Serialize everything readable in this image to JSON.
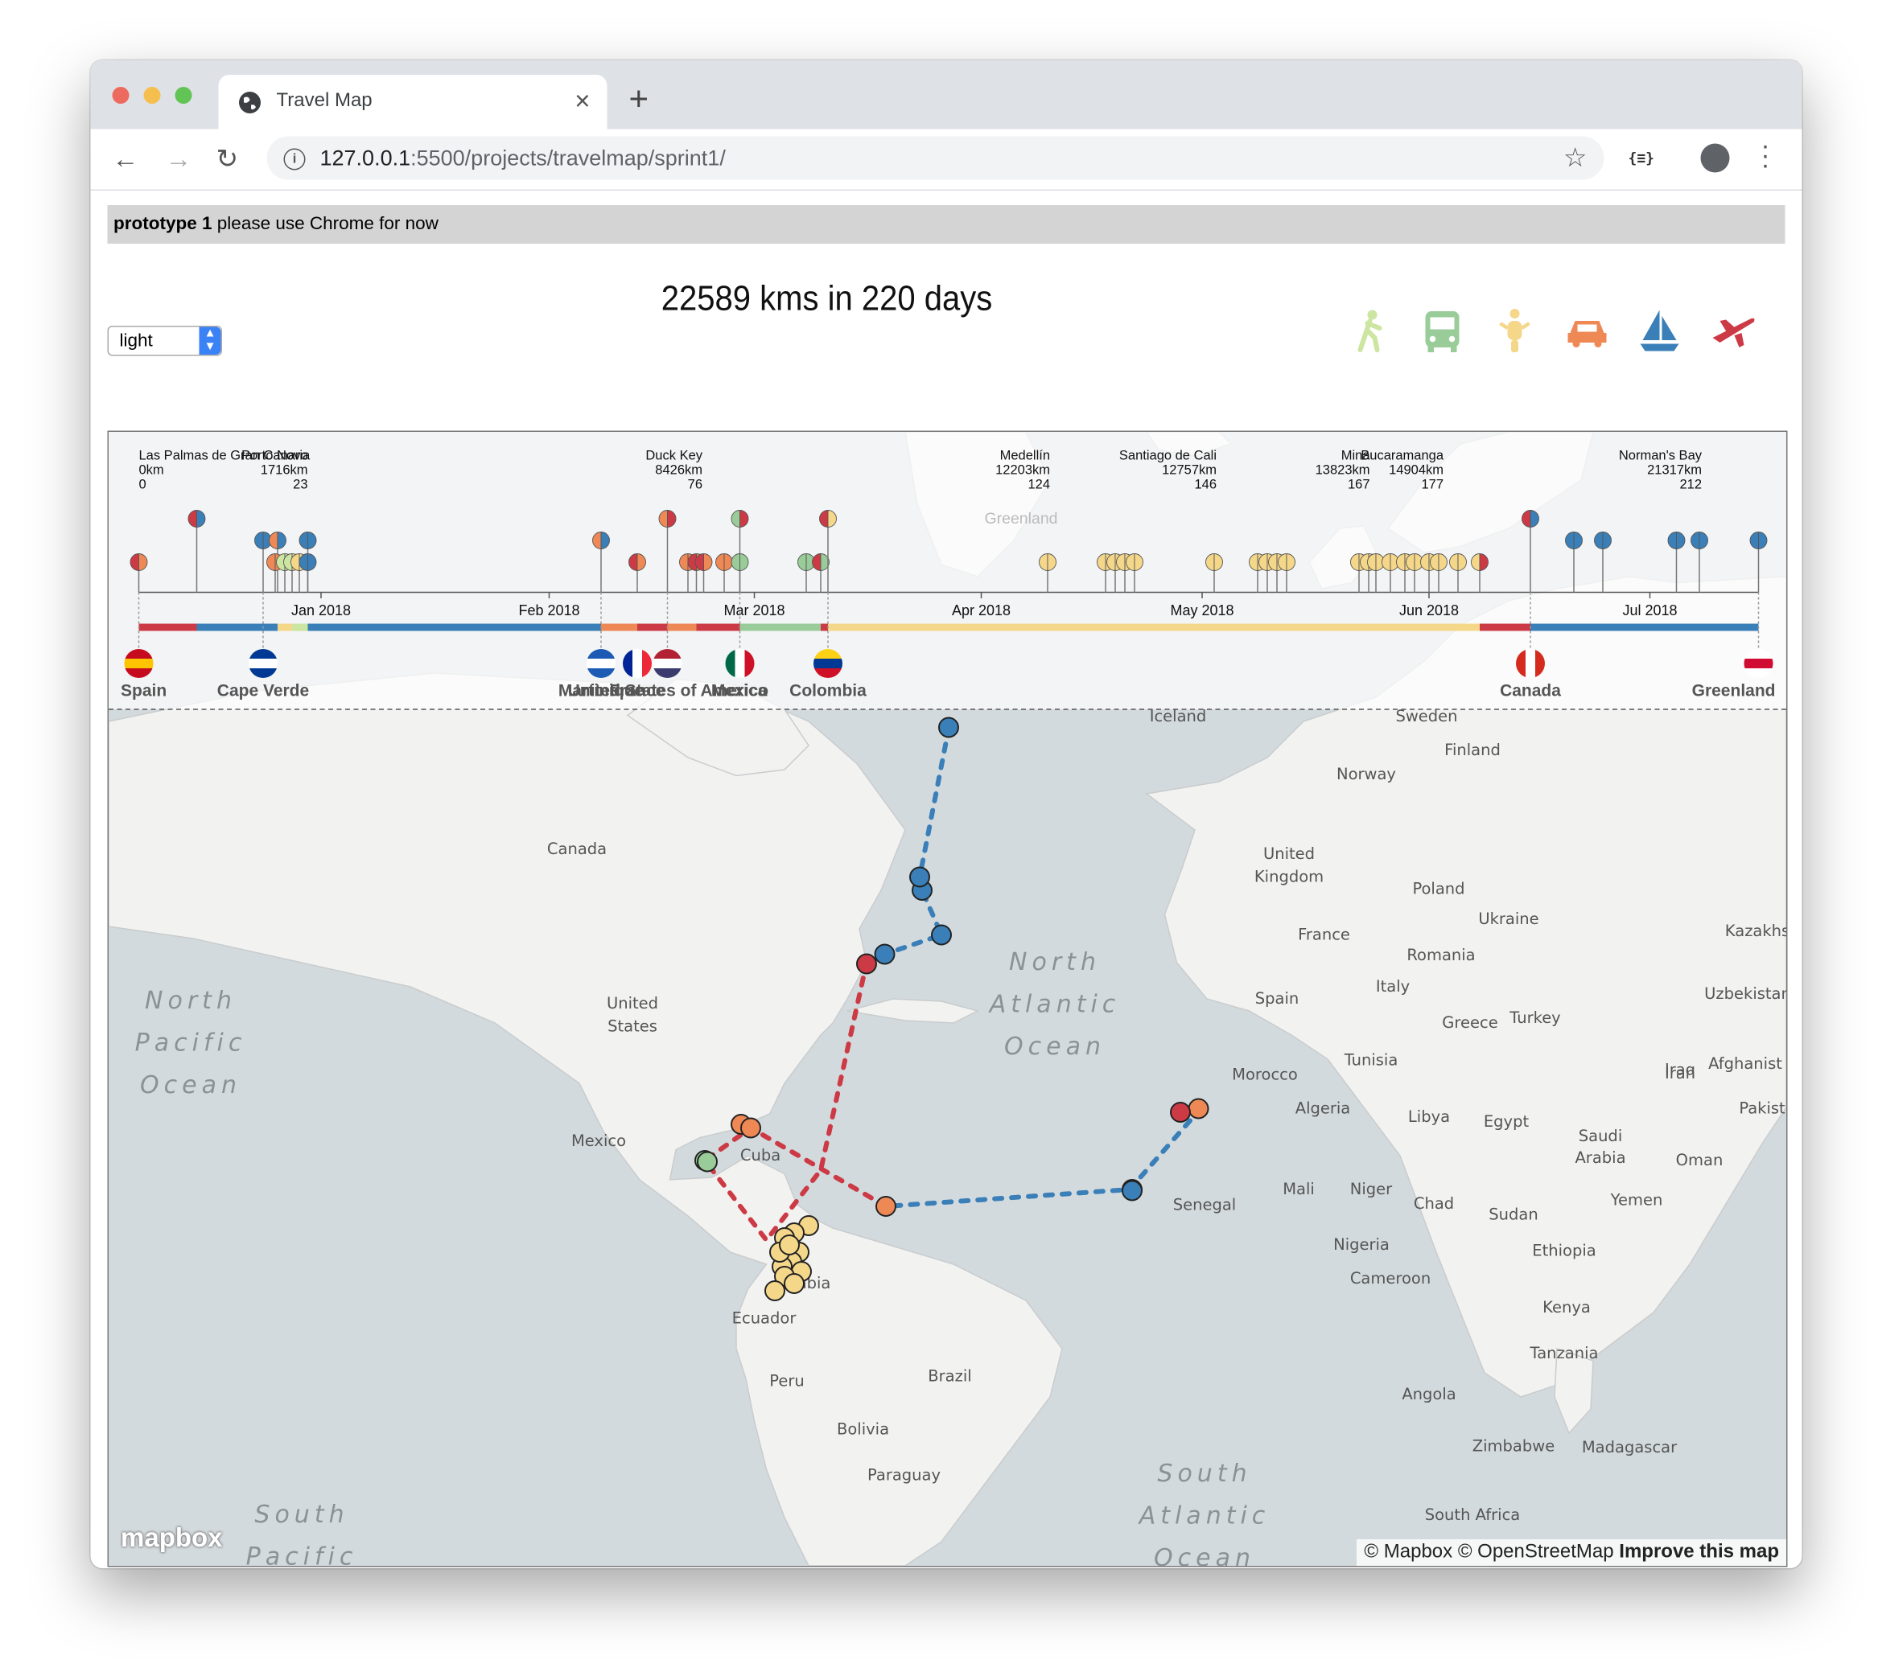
{
  "browser": {
    "tab_title": "Travel Map",
    "url_host": "127.0.0.1",
    "url_path": ":5500/projects/travelmap/sprint1/"
  },
  "banner": {
    "bold": "prototype 1",
    "text": "please use Chrome for now"
  },
  "headline": "22589 kms in 220 days",
  "theme_select": {
    "value": "light"
  },
  "modes": [
    {
      "name": "walk",
      "color": "#cce5a0"
    },
    {
      "name": "bus",
      "color": "#99cc99"
    },
    {
      "name": "scooter",
      "color": "#f5d78a"
    },
    {
      "name": "car",
      "color": "#ee8855"
    },
    {
      "name": "boat",
      "color": "#3a7fb8"
    },
    {
      "name": "plane",
      "color": "#cc3b45"
    }
  ],
  "timeline": {
    "axis_labels": [
      "Jan 2018",
      "Feb 2018",
      "Mar 2018",
      "Apr 2018",
      "May 2018",
      "Jun 2018",
      "Jul 2018"
    ],
    "stop_labels": [
      {
        "name": "Las Palmas de Gran Canaria",
        "km": "0km",
        "day": "0"
      },
      {
        "name": "Porto Novo",
        "km": "1716km",
        "day": "23"
      },
      {
        "name": "Duck Key",
        "km": "8426km",
        "day": "76"
      },
      {
        "name": "Medellín",
        "km": "12203km",
        "day": "124"
      },
      {
        "name": "Santiago de Cali",
        "km": "12757km",
        "day": "146"
      },
      {
        "name": "Mina",
        "km": "13823km",
        "day": "167"
      },
      {
        "name": "Bucaramanga",
        "km": "14904km",
        "day": "177"
      },
      {
        "name": "Norman's Bay",
        "km": "21317km",
        "day": "212"
      }
    ],
    "countries": [
      "Spain",
      "Cape Verde",
      "Martinique",
      "France",
      "United States of America",
      "Mexico",
      "Colombia",
      "Canada",
      "Greenland"
    ],
    "greenland_label": "Greenland"
  },
  "map_labels": {
    "countries": [
      "Iceland",
      "Sweden",
      "Finland",
      "Norway",
      "Canada",
      "United Kingdom",
      "Poland",
      "Ukraine",
      "France",
      "Romania",
      "Kazakhs",
      "Spain",
      "Italy",
      "Uzbekistan",
      "Greece",
      "Turkey",
      "United States",
      "Morocco",
      "Tunisia",
      "Iraq",
      "Iran",
      "Afghanist",
      "Algeria",
      "Libya",
      "Egypt",
      "Pakist",
      "Saudi Arabia",
      "Oman",
      "Mexico",
      "Cuba",
      "Mali",
      "Niger",
      "Senegal",
      "Chad",
      "Sudan",
      "Yemen",
      "Nigeria",
      "Ethiopia",
      "Cameroon",
      "mbia",
      "Ecuador",
      "Kenya",
      "Peru",
      "Brazil",
      "Tanzania",
      "Angola",
      "Bolivia",
      "Zimbabwe",
      "Madagascar",
      "Paraguay",
      "South Africa"
    ],
    "oceans": [
      "North Atlantic Ocean",
      "North Pacific Ocean",
      "South Atlantic Ocean",
      "South Pacific"
    ]
  },
  "credits": {
    "mapbox": "© Mapbox",
    "osm": "© OpenStreetMap",
    "improve": "Improve this map",
    "logo": "mapbox"
  }
}
